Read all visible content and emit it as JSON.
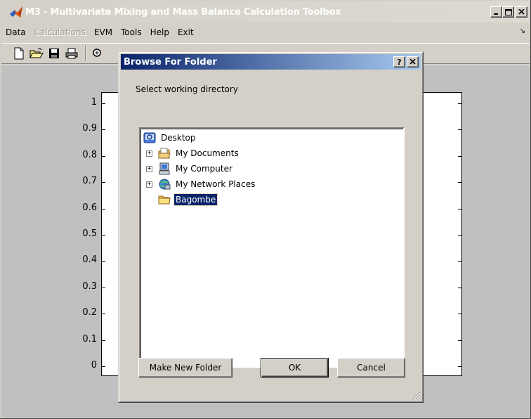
{
  "app": {
    "title": "M3 - Multivariate Mixing and Mass Balance Calculation Toolbox"
  },
  "title_buttons": {
    "minimize": "_",
    "maximize": "□",
    "close": "X"
  },
  "menu": {
    "items": [
      {
        "label": "Data",
        "disabled": false
      },
      {
        "label": "Calculations",
        "disabled": true
      },
      {
        "label": "EVM",
        "disabled": false
      },
      {
        "label": "Tools",
        "disabled": false
      },
      {
        "label": "Help",
        "disabled": false
      },
      {
        "label": "Exit",
        "disabled": false
      }
    ],
    "overflow_arrow": "↘"
  },
  "toolbar": {
    "icons": [
      "new-file-icon",
      "open-folder-icon",
      "save-icon",
      "print-icon",
      "zoom-in-icon"
    ]
  },
  "axes": {
    "y_ticks": [
      "1",
      "0.9",
      "0.8",
      "0.7",
      "0.6",
      "0.5",
      "0.4",
      "0.3",
      "0.2",
      "0.1",
      "0"
    ]
  },
  "dialog": {
    "title": "Browse For Folder",
    "help_button": "?",
    "close_button": "X",
    "prompt": "Select working directory",
    "tree": {
      "root": {
        "label": "Desktop",
        "icon": "desktop-icon"
      },
      "children": [
        {
          "label": "My Documents",
          "icon": "my-documents-icon",
          "expander": "+"
        },
        {
          "label": "My Computer",
          "icon": "my-computer-icon",
          "expander": "+"
        },
        {
          "label": "My Network Places",
          "icon": "network-places-icon",
          "expander": "+"
        },
        {
          "label": "Bagombe",
          "icon": "folder-icon",
          "selected": true
        }
      ]
    },
    "buttons": {
      "make_new_folder": "Make New Folder",
      "ok": "OK",
      "cancel": "Cancel"
    }
  },
  "colors": {
    "dialog_title_start": "#0a246a",
    "dialog_title_end": "#a6caf0",
    "selection": "#0a246a",
    "window_face": "#d4d0c8"
  }
}
